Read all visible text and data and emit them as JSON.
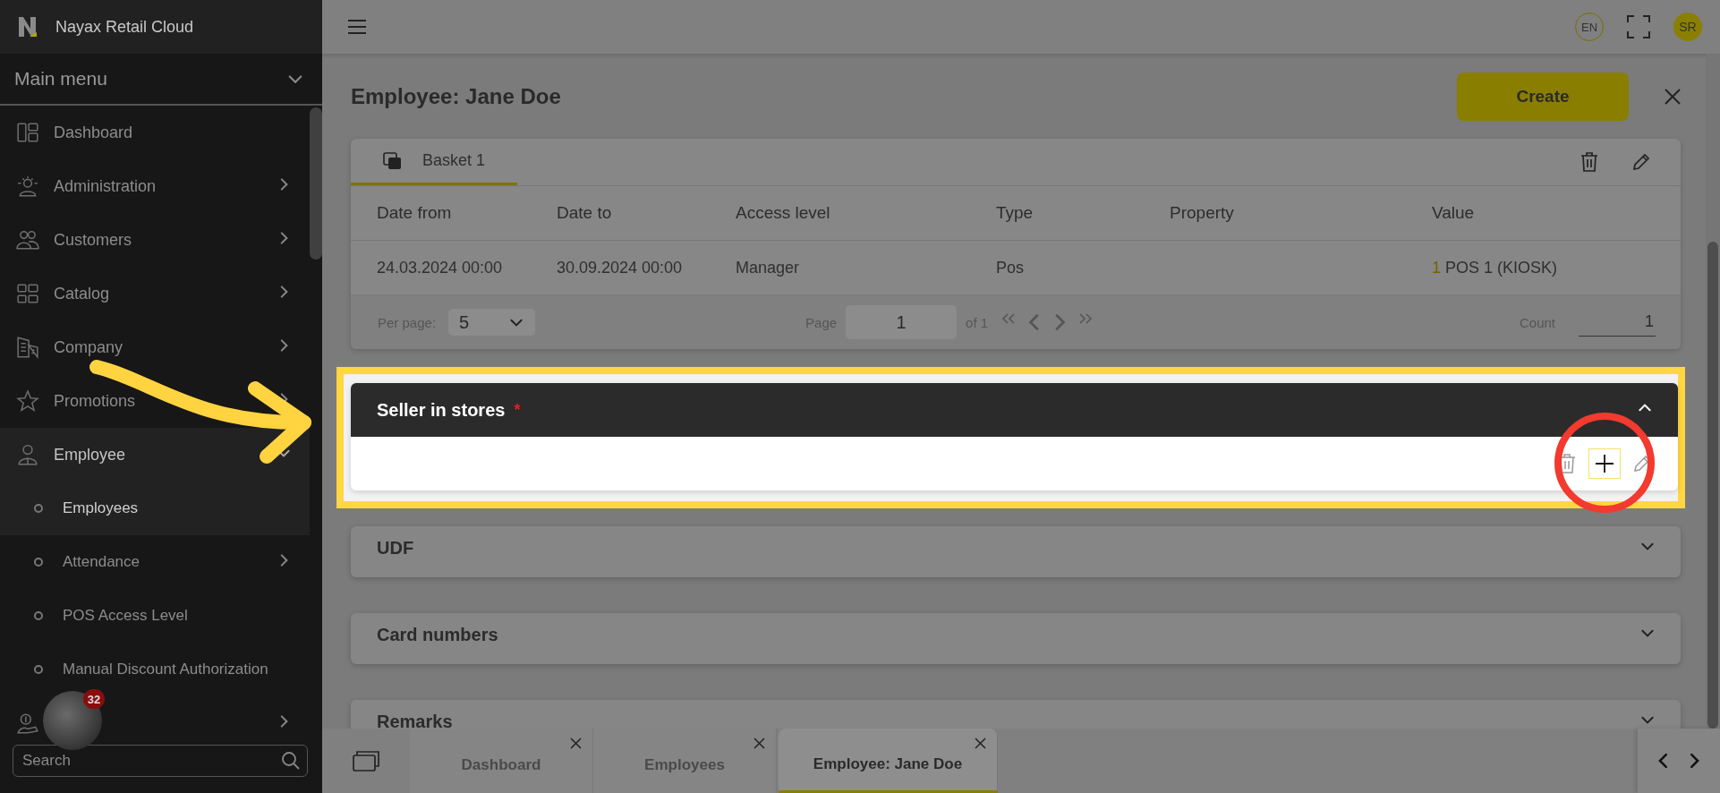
{
  "app": {
    "name": "Nayax Retail Cloud"
  },
  "sidebar": {
    "menu_title": "Main menu",
    "items": [
      {
        "label": "Dashboard",
        "selected": false
      },
      {
        "label": "Administration",
        "expanded": false,
        "selected": false
      },
      {
        "label": "Customers",
        "expanded": false,
        "selected": false
      },
      {
        "label": "Catalog",
        "expanded": false,
        "selected": false
      },
      {
        "label": "Company",
        "expanded": false,
        "selected": false
      },
      {
        "label": "Promotions",
        "expanded": false,
        "selected": false
      },
      {
        "label": "Employee",
        "expanded": true,
        "selected": true,
        "children": [
          {
            "label": "Employees",
            "selected": true
          },
          {
            "label": "Attendance",
            "expanded": false,
            "selected": false
          },
          {
            "label": "POS Access Level",
            "selected": false
          },
          {
            "label": "Manual Discount Authorization",
            "selected": false
          }
        ]
      },
      {
        "expanded": false
      }
    ],
    "search": {
      "placeholder": "Search"
    },
    "notification_count": "32"
  },
  "header": {
    "language": "EN",
    "user_initials": "SR"
  },
  "page": {
    "title": "Employee: Jane Doe",
    "create_button": "Create"
  },
  "basket": {
    "tabs": [
      {
        "label": "Basket 1",
        "selected": true
      }
    ],
    "columns": [
      "Date from",
      "Date to",
      "Access level",
      "Type",
      "Property",
      "Value"
    ],
    "rows": [
      {
        "date_from": "24.03.2024 00:00",
        "date_to": "30.09.2024 00:00",
        "access_level": "Manager",
        "type": "Pos",
        "value_count": "1",
        "value": "POS 1 (KIOSK)"
      }
    ],
    "pagination": {
      "per_page_label": "Per page:",
      "per_page": "5",
      "page_label": "Page",
      "page": "1",
      "of_pages": "of 1",
      "count_label": "Count",
      "count": "1"
    }
  },
  "required_mark": "*",
  "sections": [
    {
      "title": "Seller in stores",
      "required": true,
      "expanded": true,
      "highlighted": true
    },
    {
      "title": "UDF",
      "required": false,
      "expanded": false,
      "highlighted": false
    },
    {
      "title": "Card numbers",
      "required": false,
      "expanded": false,
      "highlighted": false
    },
    {
      "title": "Remarks",
      "required": false,
      "expanded": false,
      "highlighted": false
    }
  ],
  "bottom_tabs": [
    {
      "label": "Dashboard",
      "selected": false
    },
    {
      "label": "Employees",
      "selected": false
    },
    {
      "label": "Employee: Jane Doe",
      "selected": true
    }
  ]
}
